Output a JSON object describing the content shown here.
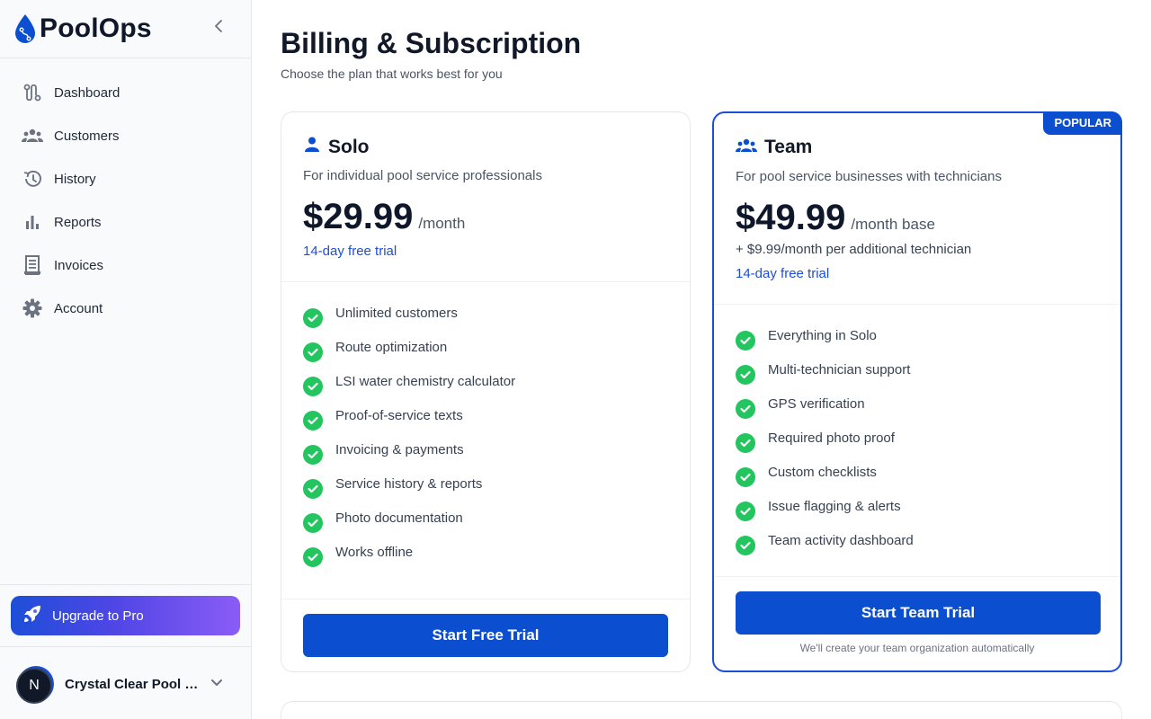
{
  "app": {
    "name": "PoolOps"
  },
  "sidebar": {
    "items": [
      {
        "label": "Dashboard",
        "icon": "route-icon"
      },
      {
        "label": "Customers",
        "icon": "users-icon"
      },
      {
        "label": "History",
        "icon": "history-icon"
      },
      {
        "label": "Reports",
        "icon": "bar-chart-icon"
      },
      {
        "label": "Invoices",
        "icon": "receipt-icon"
      },
      {
        "label": "Account",
        "icon": "gear-icon"
      }
    ],
    "upgrade_label": "Upgrade to Pro",
    "org": {
      "name": "Crystal Clear Pool Se...",
      "avatar_letter": "N"
    }
  },
  "page": {
    "title": "Billing & Subscription",
    "subtitle": "Choose the plan that works best for you"
  },
  "plans": {
    "solo": {
      "name": "Solo",
      "description": "For individual pool service professionals",
      "price": "$29.99",
      "period": "/month",
      "trial": "14-day free trial",
      "features": [
        "Unlimited customers",
        "Route optimization",
        "LSI water chemistry calculator",
        "Proof-of-service texts",
        "Invoicing & payments",
        "Service history & reports",
        "Photo documentation",
        "Works offline"
      ],
      "cta": "Start Free Trial"
    },
    "team": {
      "badge": "POPULAR",
      "name": "Team",
      "description": "For pool service businesses with technicians",
      "price": "$49.99",
      "period": "/month base",
      "addon": "+ $9.99/month per additional technician",
      "trial": "14-day free trial",
      "features": [
        "Everything in Solo",
        "Multi-technician support",
        "GPS verification",
        "Required photo proof",
        "Custom checklists",
        "Issue flagging & alerts",
        "Team activity dashboard"
      ],
      "cta": "Start Team Trial",
      "cta_note": "We'll create your team organization automatically"
    }
  },
  "colors": {
    "primary": "#0b4fd0",
    "check": "#22c55e",
    "sidebar_bg": "#f8fafc"
  }
}
